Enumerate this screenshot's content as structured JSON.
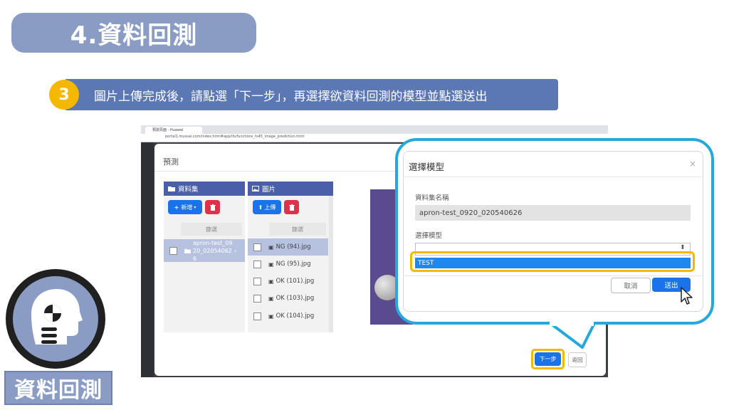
{
  "header": {
    "title": "4.資料回測"
  },
  "step": {
    "number": "3",
    "instruction": "圖片上傳完成後，請點選「下一步」，再選擇欲資料回測的模型並點選送出"
  },
  "browser": {
    "tab_title": "預測頁面 - Huawei",
    "url": "portal1.mussai.com/index.html#app/ifs/functions_ts45_image_prediction.html"
  },
  "predict_modal": {
    "title": "預測",
    "dataset_panel": {
      "header": "資料集",
      "add_label": "新增",
      "filter_placeholder": "篩選",
      "items": [
        {
          "label": "apron-test_0920_020540626",
          "selected": true
        }
      ]
    },
    "image_panel": {
      "header": "圖片",
      "upload_label": "上傳",
      "filter_placeholder": "篩選",
      "items": [
        {
          "label": "NG (94).jpg",
          "selected": true
        },
        {
          "label": "NG (95).jpg",
          "selected": false
        },
        {
          "label": "OK (101).jpg",
          "selected": false
        },
        {
          "label": "OK (103).jpg",
          "selected": false
        },
        {
          "label": "OK (104).jpg",
          "selected": false
        }
      ]
    },
    "next_label": "下一步",
    "back_label": "返回"
  },
  "model_dialog": {
    "title": "選擇模型",
    "dataset_name_label": "資料集名稱",
    "dataset_name_value": "apron-test_0920_020540626",
    "model_label": "選擇模型",
    "selected_option": "TEST",
    "cancel_label": "取消",
    "submit_label": "送出"
  },
  "sidebar_label": "資料回測",
  "colors": {
    "title_bg": "#8a9cc4",
    "step_bar": "#5b78b5",
    "step_circle": "#f5b800",
    "highlight": "#f5b800",
    "callout_border": "#25a9dd",
    "primary_button": "#1a73e8",
    "danger_button": "#e0314b",
    "panel_header": "#4a5fa8"
  },
  "icons": [
    "folder-icon",
    "image-icon",
    "plus-icon",
    "upload-icon",
    "trash-icon",
    "close-icon",
    "chevron-right-icon",
    "cursor-icon",
    "head-avatar-icon"
  ]
}
